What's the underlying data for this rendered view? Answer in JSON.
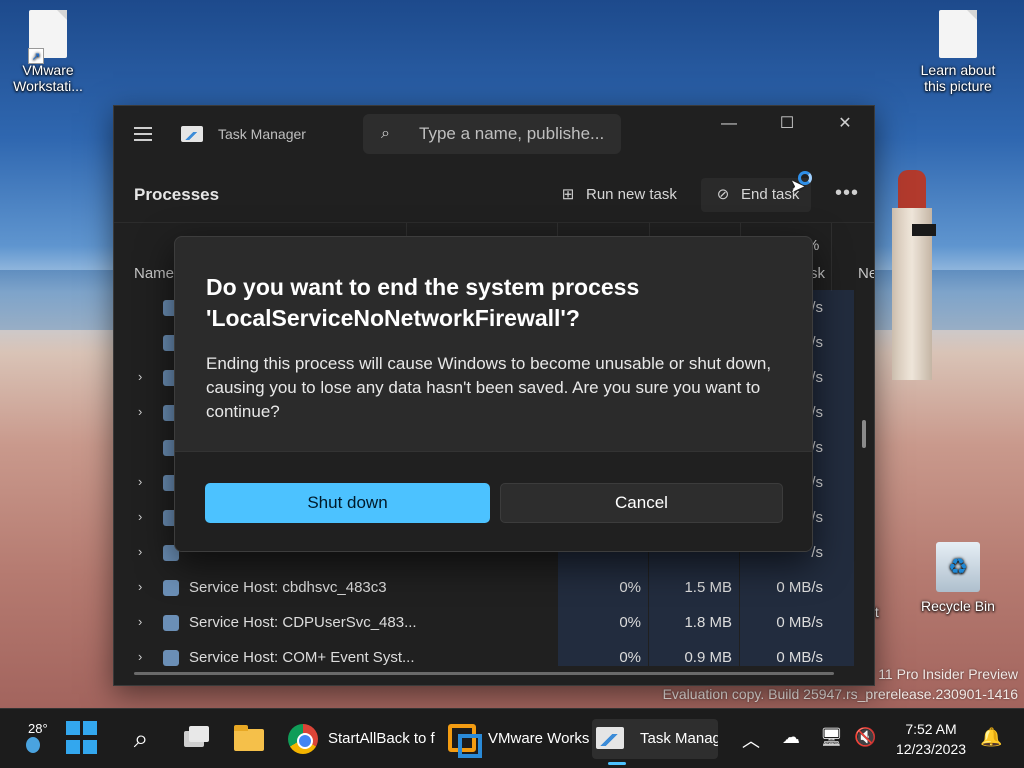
{
  "desktop": {
    "icons": [
      {
        "label_line1": "VMware",
        "label_line2": "Workstati..."
      },
      {
        "label_line1": "Learn about",
        "label_line2": "this picture"
      },
      {
        "label_line1": "Recycle Bin"
      }
    ],
    "partial_icon_label": "oft",
    "watermark": {
      "line1": "11 Pro Insider Preview",
      "line2": "Evaluation copy. Build 25947.rs_prerelease.230901-1416"
    }
  },
  "task_manager": {
    "title": "Task Manager",
    "search_placeholder": "Type a name, publishe...",
    "window_controls": {
      "minimize": "—",
      "maximize": "☐",
      "close": "✕"
    },
    "page_title": "Processes",
    "toolbar": {
      "run_new_task": "Run new task",
      "end_task": "End task",
      "more": "•••"
    },
    "columns": {
      "name": "Name",
      "disk_pct": "%",
      "disk": "sk",
      "network": "Ne"
    },
    "rows": [
      {
        "expand": "",
        "name": "",
        "cpu": "",
        "memory": "",
        "disk": "/s"
      },
      {
        "expand": "",
        "name": "",
        "cpu": "",
        "memory": "",
        "disk": "/s"
      },
      {
        "expand": "›",
        "name": "",
        "cpu": "",
        "memory": "",
        "disk": "/s"
      },
      {
        "expand": "›",
        "name": "",
        "cpu": "",
        "memory": "",
        "disk": "/s"
      },
      {
        "expand": "",
        "name": "",
        "cpu": "",
        "memory": "",
        "disk": "/s"
      },
      {
        "expand": "›",
        "name": "",
        "cpu": "",
        "memory": "",
        "disk": "/s"
      },
      {
        "expand": "›",
        "name": "",
        "cpu": "",
        "memory": "",
        "disk": "/s"
      },
      {
        "expand": "›",
        "name": "",
        "cpu": "",
        "memory": "",
        "disk": "/s"
      },
      {
        "expand": "›",
        "name": "Service Host: cbdhsvc_483c3",
        "cpu": "0%",
        "memory": "1.5 MB",
        "disk": "0 MB/s"
      },
      {
        "expand": "›",
        "name": "Service Host: CDPUserSvc_483...",
        "cpu": "0%",
        "memory": "1.8 MB",
        "disk": "0 MB/s"
      },
      {
        "expand": "›",
        "name": "Service Host: COM+ Event Syst...",
        "cpu": "0%",
        "memory": "0.9 MB",
        "disk": "0 MB/s"
      }
    ]
  },
  "dialog": {
    "title": "Do you want to end the system process 'LocalServiceNoNetworkFirewall'?",
    "body": "Ending this process will cause Windows to become unusable or shut down, causing you to lose any data hasn't been saved. Are you sure you want to continue?",
    "primary_button": "Shut down",
    "secondary_button": "Cancel"
  },
  "taskbar": {
    "weather_temp": "28°",
    "apps": [
      {
        "label": "StartAllBack to f"
      },
      {
        "label": "VMware Works"
      },
      {
        "label": "Task Manag"
      }
    ],
    "clock": {
      "time": "7:52 AM",
      "date": "12/23/2023"
    },
    "icons": [
      "start-icon",
      "search-icon",
      "task-view-icon",
      "file-explorer-icon",
      "chrome-icon",
      "vmware-icon",
      "task-manager-icon",
      "chevron-up-icon",
      "onedrive-icon",
      "network-icon",
      "volume-muted-icon",
      "notification-bell-icon"
    ]
  },
  "colors": {
    "accent": "#4cc2ff",
    "window_bg": "#202020",
    "dialog_bg": "#2b2b2b"
  }
}
